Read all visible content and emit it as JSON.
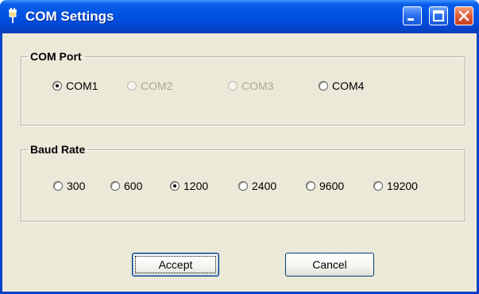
{
  "window": {
    "title": "COM Settings",
    "title_icon": "plug-icon",
    "controls": [
      "minimize-icon",
      "maximize-icon",
      "close-icon"
    ]
  },
  "com_port": {
    "label": "COM Port",
    "options": [
      {
        "label": "COM1",
        "checked": true,
        "enabled": true
      },
      {
        "label": "COM2",
        "checked": false,
        "enabled": false
      },
      {
        "label": "COM3",
        "checked": false,
        "enabled": false
      },
      {
        "label": "COM4",
        "checked": false,
        "enabled": true
      }
    ]
  },
  "baud_rate": {
    "label": "Baud Rate",
    "options": [
      {
        "label": "300",
        "checked": false,
        "enabled": true
      },
      {
        "label": "600",
        "checked": false,
        "enabled": true
      },
      {
        "label": "1200",
        "checked": true,
        "enabled": true
      },
      {
        "label": "2400",
        "checked": false,
        "enabled": true
      },
      {
        "label": "9600",
        "checked": false,
        "enabled": true
      },
      {
        "label": "19200",
        "checked": false,
        "enabled": true
      }
    ]
  },
  "buttons": {
    "accept": "Accept",
    "cancel": "Cancel"
  },
  "colors": {
    "titlebar": "#0054e3",
    "dialog_bg": "#ece9d8",
    "disabled_text": "#aca899"
  }
}
